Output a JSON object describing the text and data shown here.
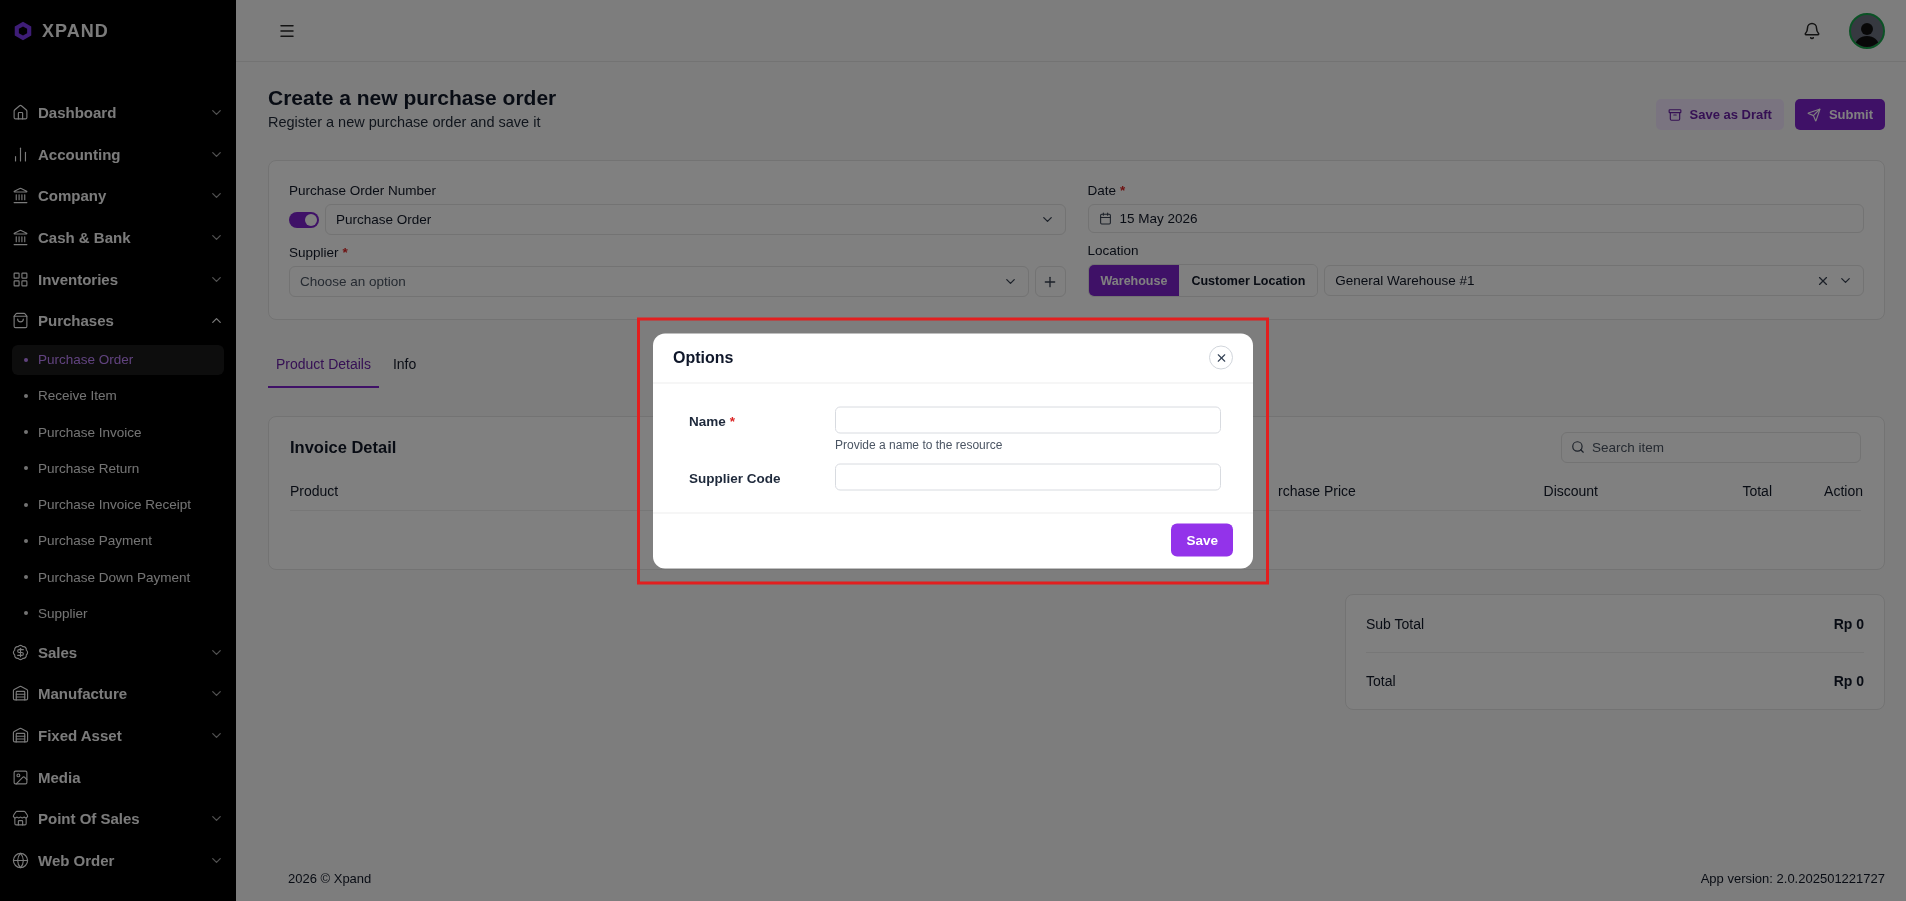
{
  "brand": {
    "name": "XPAND"
  },
  "sidebar": {
    "items": [
      {
        "label": "Dashboard",
        "kind": "group",
        "expanded": false
      },
      {
        "label": "Accounting",
        "kind": "group",
        "expanded": false
      },
      {
        "label": "Company",
        "kind": "group",
        "expanded": false
      },
      {
        "label": "Cash & Bank",
        "kind": "group",
        "expanded": false
      },
      {
        "label": "Inventories",
        "kind": "group",
        "expanded": false
      },
      {
        "label": "Purchases",
        "kind": "group",
        "expanded": true,
        "children": [
          {
            "label": "Purchase Order",
            "selected": true
          },
          {
            "label": "Receive Item",
            "selected": false
          },
          {
            "label": "Purchase Invoice",
            "selected": false
          },
          {
            "label": "Purchase Return",
            "selected": false
          },
          {
            "label": "Purchase Invoice Receipt",
            "selected": false
          },
          {
            "label": "Purchase Payment",
            "selected": false
          },
          {
            "label": "Purchase Down Payment",
            "selected": false
          },
          {
            "label": "Supplier",
            "selected": false
          }
        ]
      },
      {
        "label": "Sales",
        "kind": "group",
        "expanded": false
      },
      {
        "label": "Manufacture",
        "kind": "group",
        "expanded": false
      },
      {
        "label": "Fixed Asset",
        "kind": "group",
        "expanded": false
      },
      {
        "label": "Media",
        "kind": "link"
      },
      {
        "label": "Point Of Sales",
        "kind": "group",
        "expanded": false
      },
      {
        "label": "Web Order",
        "kind": "group",
        "expanded": false
      }
    ]
  },
  "page": {
    "title": "Create a new purchase order",
    "subtitle": "Register a new purchase order and save it",
    "actions": [
      {
        "label": "Save as Draft",
        "kind": "secondary"
      },
      {
        "label": "Submit",
        "kind": "primary"
      }
    ]
  },
  "form": {
    "po_number": {
      "label": "Purchase Order Number",
      "on": true,
      "value": "Purchase Order"
    },
    "supplier": {
      "label": "Supplier",
      "required_mark": "*",
      "placeholder": "Choose an option"
    },
    "date": {
      "label": "Date",
      "required_mark": "*",
      "value": "15 May 2026"
    },
    "location": {
      "label": "Location",
      "options": [
        {
          "label": "Warehouse",
          "selected": true
        },
        {
          "label": "Customer Location",
          "selected": false
        }
      ],
      "value": "General Warehouse #1"
    }
  },
  "tabs": [
    {
      "label": "Product Details",
      "selected": true
    },
    {
      "label": "Info",
      "selected": false
    }
  ],
  "invoice": {
    "title": "Invoice Detail",
    "search_placeholder": "Search item",
    "columns": [
      "Product",
      "rchase Price",
      "Discount",
      "Total",
      "Action"
    ]
  },
  "totals": [
    {
      "label": "Sub Total",
      "value": "Rp 0"
    },
    {
      "label": "Total",
      "value": "Rp 0"
    }
  ],
  "footer": {
    "copyright": "2026 © Xpand",
    "version": "App version: 2.0.202501221727"
  },
  "modal": {
    "title": "Options",
    "fields": [
      {
        "label": "Name",
        "required_mark": "*",
        "hint": "Provide a name to the resource"
      },
      {
        "label": "Supplier Code"
      }
    ],
    "submit": "Save"
  }
}
